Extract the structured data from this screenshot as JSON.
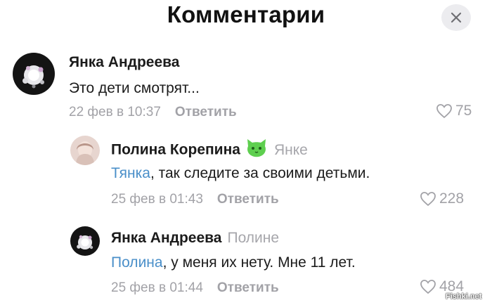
{
  "header": {
    "title": "Комментарии"
  },
  "comments": [
    {
      "author": "Янка Андреева",
      "reply_to": "",
      "mention": "",
      "text": "Это дети смотрят...",
      "date": "22 фев в 10:37",
      "reply_label": "Ответить",
      "likes": "75"
    },
    {
      "author": "Полина Корепина",
      "reply_to": "Янке",
      "mention": "Тянка",
      "text": ", так следите за своими детьми.",
      "date": "25 фев в 01:43",
      "reply_label": "Ответить",
      "likes": "228"
    },
    {
      "author": "Янка Андреева",
      "reply_to": "Полине",
      "mention": "Полина",
      "text": ", у меня их нету. Мне 11 лет.",
      "date": "25 фев в 01:44",
      "reply_label": "Ответить",
      "likes": "484"
    }
  ],
  "watermark": "Fishki.net",
  "icons": {
    "close": "close-icon",
    "like": "heart-outline-icon",
    "badge": "green-cat-icon"
  },
  "colors": {
    "mention": "#4a8fc9",
    "muted": "#a2a2a7",
    "text": "#1b1b1b"
  }
}
